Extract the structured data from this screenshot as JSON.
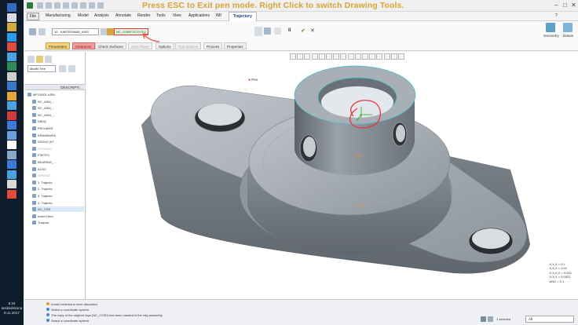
{
  "taskbar": {
    "time": "8.34",
    "day": "keskiviikkona",
    "date": "8.11.2017",
    "icons": [
      "#3c7ad8",
      "#ffffff",
      "#f2c641",
      "#2a9de8",
      "#e04a3a",
      "#4aa3df",
      "#2e8b57",
      "#cfcfcf",
      "#3a78c8",
      "#e8a33a",
      "#4aa3df",
      "#d43a3a",
      "#3c7ad8",
      "#6ba0dc",
      "#ffffff",
      "#88a8c8",
      "#3c7ad8",
      "#4aa3df",
      "#d8d8d8",
      "#e04a3a"
    ]
  },
  "banner": "Press ESC to Exit pen mode.  Right Click to switch Drawing Tools.",
  "menu": [
    "File",
    "Manufacturing",
    "Model",
    "Analysis",
    "Annotate",
    "Render",
    "Tools",
    "View",
    "Applications",
    "IMI",
    "Trajectory"
  ],
  "ribbon": {
    "mode_value": "10 : KARTESIAN5_AXIS",
    "csys_value": "NC_OSBIF7/CSYS:0",
    "check_label": "✔",
    "close_label": "✕",
    "pause_label": "II",
    "subtabs": [
      "Parameters",
      "Clearance",
      "Check Surfaces",
      "Axes Plane",
      "Options",
      "Tool Motions",
      "Process",
      "Properties"
    ],
    "geometry_label": "Geometry",
    "datum_label": "Datum"
  },
  "tree": {
    "header": "DESCRIPTI...",
    "title": "Model Tree",
    "rows": [
      {
        "text": "MFG0001.ASM",
        "state": "normal"
      },
      {
        "text": "NC_ASM_...",
        "state": "normal"
      },
      {
        "text": "NC_ASM_...",
        "state": "normal"
      },
      {
        "text": "NC_ASM_...",
        "state": "normal"
      },
      {
        "text": "DB0Q",
        "state": "normal"
      },
      {
        "text": "PROLBHR",
        "state": "normal"
      },
      {
        "text": "KRANMURA",
        "state": "normal"
      },
      {
        "text": "DIS010 [KT",
        "state": "normal"
      },
      {
        "text": "TOOLING",
        "state": "dim"
      },
      {
        "text": "FSETP1",
        "state": "normal"
      },
      {
        "text": "BEARING_...",
        "state": "normal"
      },
      {
        "text": "ACS0",
        "state": "normal"
      },
      {
        "text": "OPERAT...",
        "state": "dim"
      },
      {
        "text": "1. Trajecto",
        "state": "normal"
      },
      {
        "text": "2. Trajecto",
        "state": "normal"
      },
      {
        "text": "3. Trajecto",
        "state": "normal"
      },
      {
        "text": "4. Trajecto",
        "state": "normal"
      },
      {
        "text": "NC_CSS",
        "state": "sel"
      },
      {
        "text": "Insert Here",
        "state": "normal"
      },
      {
        "text": "Trajecto",
        "state": "normal"
      }
    ]
  },
  "graphics": {
    "pen_label": "Pen",
    "coords": [
      "X,X,X = 0.1",
      "X,X,X = 0.01",
      "X,X,X,X = 0.001",
      "X,X,X = 0.0001",
      "ANG = 0.1"
    ]
  },
  "status": {
    "messages": [
      "Invalid selections were discarded.",
      "Select a coordinate system.",
      "The copy of the original csys (NC_CSS0) has been created in the mfg assembly.",
      "Select a coordinate system."
    ],
    "selected": "1 selected",
    "filter": "All"
  },
  "colors": {
    "banner": "#d8a433",
    "part_face": "#9ea5ad",
    "part_dark": "#6e757d",
    "part_light": "#c5cbd1",
    "annotation_red": "#e03a3a",
    "selected_tab": "#f7d47b"
  }
}
